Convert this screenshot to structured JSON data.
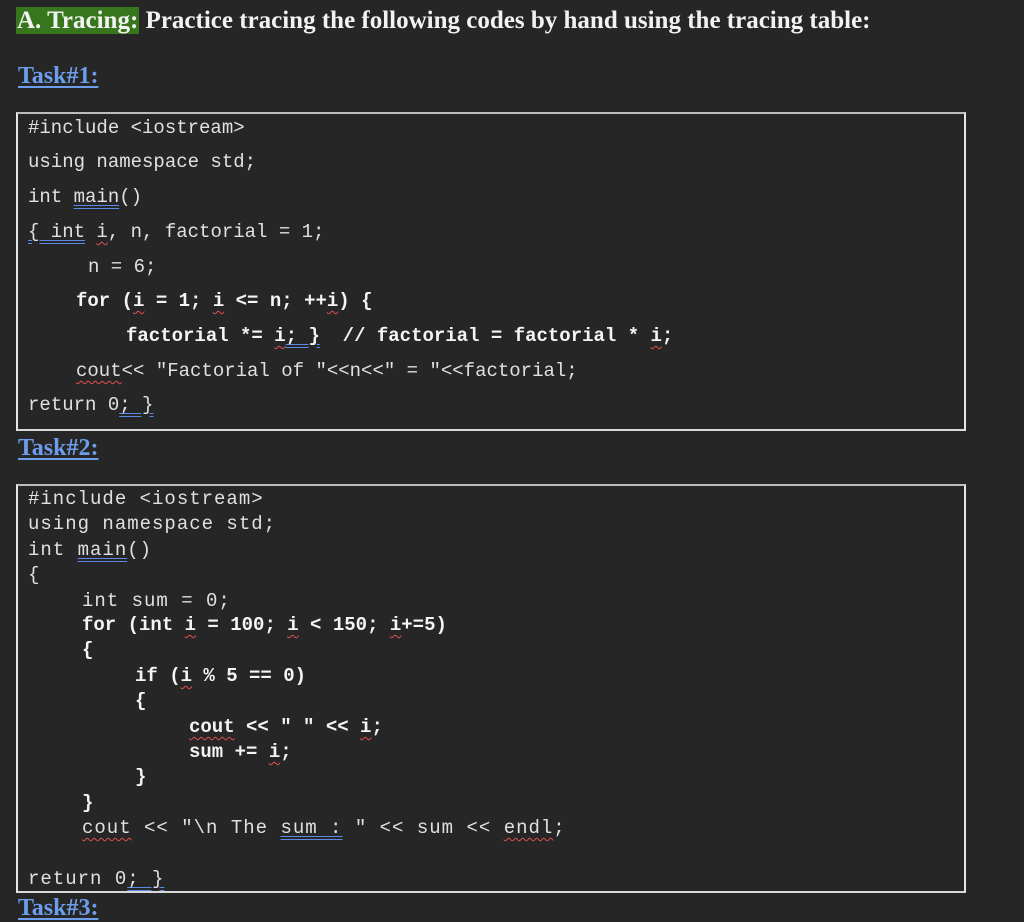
{
  "heading": {
    "highlight": "A. Tracing:",
    "rest": " Practice tracing the following codes by hand using the tracing table:"
  },
  "tasks": [
    {
      "label": "Task#1:",
      "lines": [
        "#include <iostream>",
        "using namespace std;",
        "int main()",
        "{ int i, n, factorial = 1;",
        "n = 6;",
        "for (i = 1; i <= n; ++i) {",
        "factorial *= i; }  // factorial = factorial * i;",
        "cout<< \"Factorial of \"<<n<<\" = \"<<factorial;",
        "return 0; }"
      ]
    },
    {
      "label": "Task#2:",
      "lines": [
        "#include <iostream>",
        "using namespace std;",
        "int main()",
        "{",
        "int sum = 0;",
        "for (int i = 100; i < 150; i+=5)",
        "{",
        "if (i % 5 == 0)",
        "{",
        "cout << \" \" << i;",
        "sum += i;",
        "}",
        "}",
        "cout << \"\\n The sum : \" << sum << endl;",
        "return 0; }"
      ]
    },
    {
      "label": "Task#3:"
    }
  ],
  "colors": {
    "background": "#262626",
    "heading_highlight": "#38761d",
    "task_label": "#6d9eeb",
    "spell_squiggle": "#e05050",
    "grammar_underline": "#5b8be6"
  }
}
